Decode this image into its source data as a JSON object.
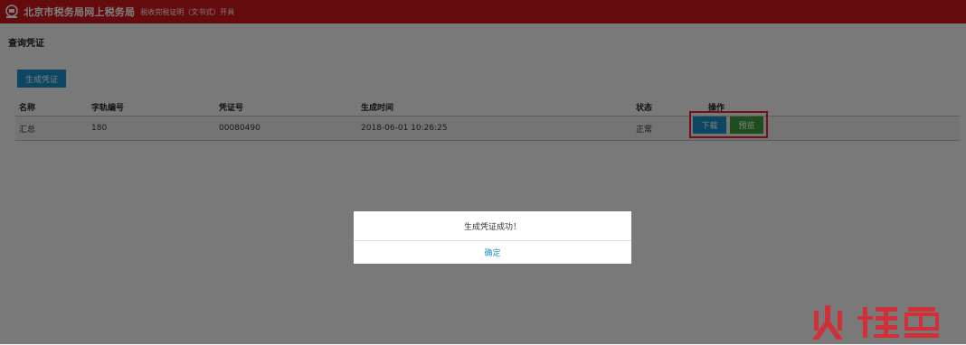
{
  "header": {
    "site_title": "北京市税务局网上税务局",
    "subtitle": "税收完税证明（文书式）开具"
  },
  "page": {
    "title": "查询凭证",
    "generate_button": "生成凭证"
  },
  "table": {
    "columns": [
      "名称",
      "字轨编号",
      "凭证号",
      "生成时间",
      "状态",
      "操作"
    ],
    "rows": [
      {
        "name": "汇总",
        "track_no": "180",
        "cert_no": "00080490",
        "created_at": "2018-06-01 10:26:25",
        "status": "正常",
        "actions": {
          "download": "下载",
          "preview": "预览"
        }
      }
    ]
  },
  "dialog": {
    "message": "生成凭证成功！",
    "confirm": "确定"
  },
  "colors": {
    "header_bg": "#c8161d",
    "primary_button": "#1a8cc4",
    "preview_button": "#3c9c3c",
    "highlight_border": "#e0252e"
  }
}
